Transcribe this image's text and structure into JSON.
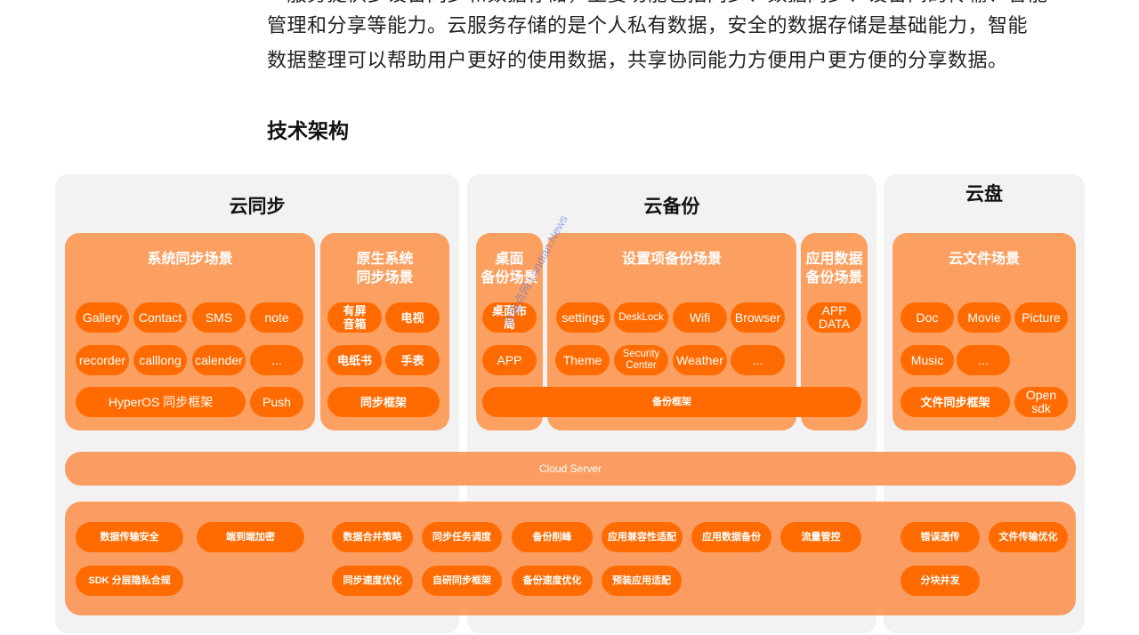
{
  "article": {
    "partial_line": "一服务提供多设备同步和数据存储，主要功能包括同步、数据同步、设备间的传输、智能",
    "lines": [
      "管理和分享等能力。云服务存储的是个人私有数据，安全的数据存储是基础能力，智能",
      "数据整理可以帮助用户更好的使用数据，共享协同能力方便用户更方便的分享数据。"
    ],
    "heading": "技术架构"
  },
  "diagram": {
    "columns": {
      "sync": {
        "title": "云同步"
      },
      "backup": {
        "title": "云备份"
      },
      "disk": {
        "title": "云盘"
      }
    },
    "groups": {
      "system_sync": {
        "title": "系统同步场景",
        "items": [
          "Gallery",
          "Contact",
          "SMS",
          "note",
          "recorder",
          "calllong",
          "calender",
          "..."
        ],
        "framework": "HyperOS 同步框架",
        "extra": "Push"
      },
      "native_sync": {
        "title_line1": "原生系统",
        "title_line2": "同步场景",
        "items": [
          "有屏\n音箱",
          "电视",
          "电纸书",
          "手表"
        ],
        "framework": "同步框架"
      },
      "desktop_backup": {
        "title_line1": "桌面",
        "title_line2": "备份场景",
        "items": [
          "桌面布\n局",
          "APP"
        ]
      },
      "settings_backup": {
        "title": "设置项备份场景",
        "items": [
          "settings",
          "DeskLock",
          "Wifi",
          "Browser",
          "Theme",
          "Security\nCenter",
          "Weather",
          "..."
        ]
      },
      "appdata_backup": {
        "title_line1": "应用数据",
        "title_line2": "备份场景",
        "items": [
          "APP\nDATA"
        ]
      },
      "backup_framework": "备份框架",
      "cloud_file": {
        "title": "云文件场景",
        "items": [
          "Doc",
          "Movie",
          "Picture",
          "Music",
          "..."
        ],
        "framework": "文件同步框架",
        "extra": "Open\nsdk"
      }
    },
    "cloud_server": "Cloud Server",
    "capabilities": {
      "sync": [
        "数据传输安全",
        "端到端加密",
        "SDK 分层隐私合规"
      ],
      "backup_row1": [
        "数据合并策略",
        "同步任务调度",
        "备份削峰",
        "应用兼容性适配",
        "应用数据备份",
        "流量管控"
      ],
      "backup_row2": [
        "同步速度优化",
        "自研同步框架",
        "备份速度优化",
        "预装应用适配"
      ],
      "disk": [
        "错误透传",
        "文件传输优化",
        "分块并发"
      ]
    },
    "colors": {
      "column_bg": "#f2f2f2",
      "group_bg": "#fca062",
      "pill_bg": "#ff6b00",
      "text_on_orange": "#ffffff"
    }
  },
  "watermark": "@蓝点网 Landian.News"
}
